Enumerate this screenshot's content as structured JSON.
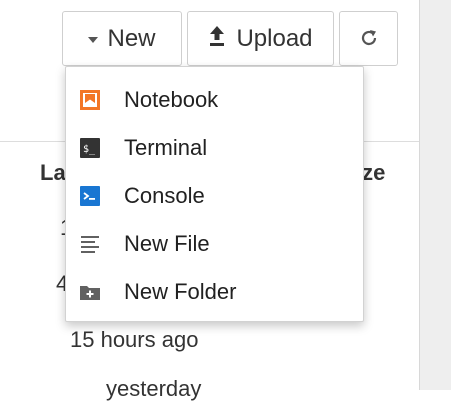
{
  "toolbar": {
    "new_label": "New",
    "upload_label": "Upload"
  },
  "file_list": {
    "headers": {
      "last_modified_partial": "La",
      "size_partial": "ize"
    },
    "visible_fragments": [
      "1",
      "4"
    ],
    "modified": [
      "15 hours ago",
      "yesterday"
    ]
  },
  "new_menu": {
    "items": [
      {
        "label": "Notebook",
        "icon": "notebook-icon"
      },
      {
        "label": "Terminal",
        "icon": "terminal-icon"
      },
      {
        "label": "Console",
        "icon": "console-icon"
      },
      {
        "label": "New File",
        "icon": "file-text-icon"
      },
      {
        "label": "New Folder",
        "icon": "new-folder-icon"
      }
    ]
  },
  "colors": {
    "notebook_orange": "#f37626",
    "console_blue": "#1976d2",
    "terminal_dark": "#333333",
    "icon_gray": "#616161"
  }
}
